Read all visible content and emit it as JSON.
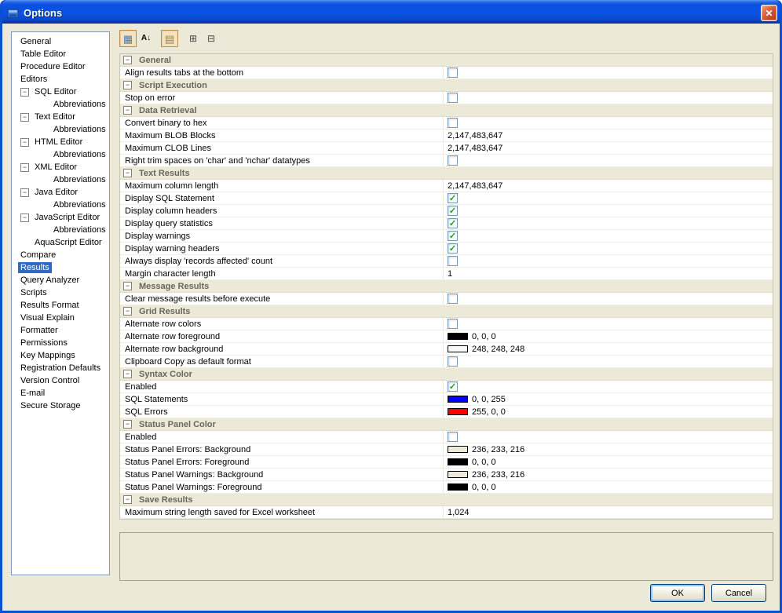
{
  "window": {
    "title": "Options"
  },
  "icons": {
    "app": "app-icon",
    "close": "✕",
    "categorized": "▦",
    "sort_alphabetical": "A↓",
    "show_description": "▤",
    "expand_all": "⊞",
    "collapse_all": "⊟",
    "collapse_section": "−",
    "check": "✓"
  },
  "sidebar": {
    "items": [
      {
        "label": "General",
        "indent": 0,
        "expander": false,
        "selected": false
      },
      {
        "label": "Table Editor",
        "indent": 0,
        "expander": false,
        "selected": false
      },
      {
        "label": "Procedure Editor",
        "indent": 0,
        "expander": false,
        "selected": false
      },
      {
        "label": "Editors",
        "indent": 0,
        "expander": false,
        "selected": false
      },
      {
        "label": "SQL Editor",
        "indent": 1,
        "expander": true,
        "selected": false
      },
      {
        "label": "Abbreviations",
        "indent": 2,
        "expander": false,
        "selected": false
      },
      {
        "label": "Text Editor",
        "indent": 1,
        "expander": true,
        "selected": false
      },
      {
        "label": "Abbreviations",
        "indent": 2,
        "expander": false,
        "selected": false
      },
      {
        "label": "HTML Editor",
        "indent": 1,
        "expander": true,
        "selected": false
      },
      {
        "label": "Abbreviations",
        "indent": 2,
        "expander": false,
        "selected": false
      },
      {
        "label": "XML Editor",
        "indent": 1,
        "expander": true,
        "selected": false
      },
      {
        "label": "Abbreviations",
        "indent": 2,
        "expander": false,
        "selected": false
      },
      {
        "label": "Java Editor",
        "indent": 1,
        "expander": true,
        "selected": false
      },
      {
        "label": "Abbreviations",
        "indent": 2,
        "expander": false,
        "selected": false
      },
      {
        "label": "JavaScript Editor",
        "indent": 1,
        "expander": true,
        "selected": false
      },
      {
        "label": "Abbreviations",
        "indent": 2,
        "expander": false,
        "selected": false
      },
      {
        "label": "AquaScript Editor",
        "indent": 1,
        "expander": false,
        "selected": false
      },
      {
        "label": "Compare",
        "indent": 0,
        "expander": false,
        "selected": false
      },
      {
        "label": "Results",
        "indent": 0,
        "expander": false,
        "selected": true
      },
      {
        "label": "Query Analyzer",
        "indent": 0,
        "expander": false,
        "selected": false
      },
      {
        "label": "Scripts",
        "indent": 0,
        "expander": false,
        "selected": false
      },
      {
        "label": "Results Format",
        "indent": 0,
        "expander": false,
        "selected": false
      },
      {
        "label": "Visual Explain",
        "indent": 0,
        "expander": false,
        "selected": false
      },
      {
        "label": "Formatter",
        "indent": 0,
        "expander": false,
        "selected": false
      },
      {
        "label": "Permissions",
        "indent": 0,
        "expander": false,
        "selected": false
      },
      {
        "label": "Key Mappings",
        "indent": 0,
        "expander": false,
        "selected": false
      },
      {
        "label": "Registration Defaults",
        "indent": 0,
        "expander": false,
        "selected": false
      },
      {
        "label": "Version Control",
        "indent": 0,
        "expander": false,
        "selected": false
      },
      {
        "label": "E-mail",
        "indent": 0,
        "expander": false,
        "selected": false
      },
      {
        "label": "Secure Storage",
        "indent": 0,
        "expander": false,
        "selected": false
      }
    ]
  },
  "toolbar": {
    "buttons": [
      {
        "name": "categorized-view-button",
        "icon": "categorized",
        "pressed": true,
        "gap_after": false
      },
      {
        "name": "sort-alphabetical-button",
        "icon": "sort_alphabetical",
        "pressed": false,
        "gap_after": true
      },
      {
        "name": "show-description-button",
        "icon": "show_description",
        "pressed": true,
        "gap_after": true
      },
      {
        "name": "expand-all-button",
        "icon": "expand_all",
        "pressed": false,
        "gap_after": false
      },
      {
        "name": "collapse-all-button",
        "icon": "collapse_all",
        "pressed": false,
        "gap_after": false
      }
    ]
  },
  "grid": {
    "sections": [
      {
        "title": "General",
        "rows": [
          {
            "label": "Align results tabs at the bottom",
            "type": "checkbox",
            "checked": false
          }
        ]
      },
      {
        "title": "Script Execution",
        "rows": [
          {
            "label": "Stop on error",
            "type": "checkbox",
            "checked": false
          }
        ]
      },
      {
        "title": "Data Retrieval",
        "rows": [
          {
            "label": "Convert binary to hex",
            "type": "checkbox",
            "checked": false
          },
          {
            "label": "Maximum BLOB Blocks",
            "type": "text",
            "value": "2,147,483,647"
          },
          {
            "label": "Maximum CLOB Lines",
            "type": "text",
            "value": "2,147,483,647"
          },
          {
            "label": "Right trim spaces on 'char' and 'nchar' datatypes",
            "type": "checkbox",
            "checked": false
          }
        ]
      },
      {
        "title": "Text Results",
        "rows": [
          {
            "label": "Maximum column length",
            "type": "text",
            "value": "2,147,483,647"
          },
          {
            "label": "Display SQL Statement",
            "type": "checkbox",
            "checked": true
          },
          {
            "label": "Display column headers",
            "type": "checkbox",
            "checked": true
          },
          {
            "label": "Display query statistics",
            "type": "checkbox",
            "checked": true
          },
          {
            "label": "Display warnings",
            "type": "checkbox",
            "checked": true
          },
          {
            "label": "Display warning headers",
            "type": "checkbox",
            "checked": true
          },
          {
            "label": "Always display 'records affected' count",
            "type": "checkbox",
            "checked": false
          },
          {
            "label": "Margin character length",
            "type": "text",
            "value": "1"
          }
        ]
      },
      {
        "title": "Message Results",
        "rows": [
          {
            "label": "Clear message results before execute",
            "type": "checkbox",
            "checked": false
          }
        ]
      },
      {
        "title": "Grid Results",
        "rows": [
          {
            "label": "Alternate row colors",
            "type": "checkbox",
            "checked": false
          },
          {
            "label": "Alternate row foreground",
            "type": "color",
            "value": "0, 0, 0",
            "swatch": "#000000"
          },
          {
            "label": "Alternate row background",
            "type": "color",
            "value": "248, 248, 248",
            "swatch": "#F8F8F8"
          },
          {
            "label": "Clipboard Copy as default format",
            "type": "checkbox",
            "checked": false
          }
        ]
      },
      {
        "title": "Syntax Color",
        "rows": [
          {
            "label": "Enabled",
            "type": "checkbox",
            "checked": true
          },
          {
            "label": "SQL Statements",
            "type": "color",
            "value": "0, 0, 255",
            "swatch": "#0000FF"
          },
          {
            "label": "SQL Errors",
            "type": "color",
            "value": "255, 0, 0",
            "swatch": "#FF0000"
          }
        ]
      },
      {
        "title": "Status Panel Color",
        "rows": [
          {
            "label": "Enabled",
            "type": "checkbox",
            "checked": false
          },
          {
            "label": "Status Panel Errors: Background",
            "type": "color",
            "value": "236, 233, 216",
            "swatch": "#ECE9D8"
          },
          {
            "label": "Status Panel Errors: Foreground",
            "type": "color",
            "value": "0, 0, 0",
            "swatch": "#000000"
          },
          {
            "label": "Status Panel Warnings: Background",
            "type": "color",
            "value": "236, 233, 216",
            "swatch": "#ECE9D8"
          },
          {
            "label": "Status Panel Warnings: Foreground",
            "type": "color",
            "value": "0, 0, 0",
            "swatch": "#000000"
          }
        ]
      },
      {
        "title": "Save Results",
        "rows": [
          {
            "label": "Maximum string length saved for Excel worksheet",
            "type": "text",
            "value": "1,024"
          }
        ]
      }
    ]
  },
  "footer": {
    "ok_label": "OK",
    "cancel_label": "Cancel"
  },
  "colors": {
    "titlebar_blue": "#0B53E6",
    "selection_blue": "#316AC5",
    "dialog_beige": "#ECE9D8",
    "check_green": "#1F9A1F"
  }
}
